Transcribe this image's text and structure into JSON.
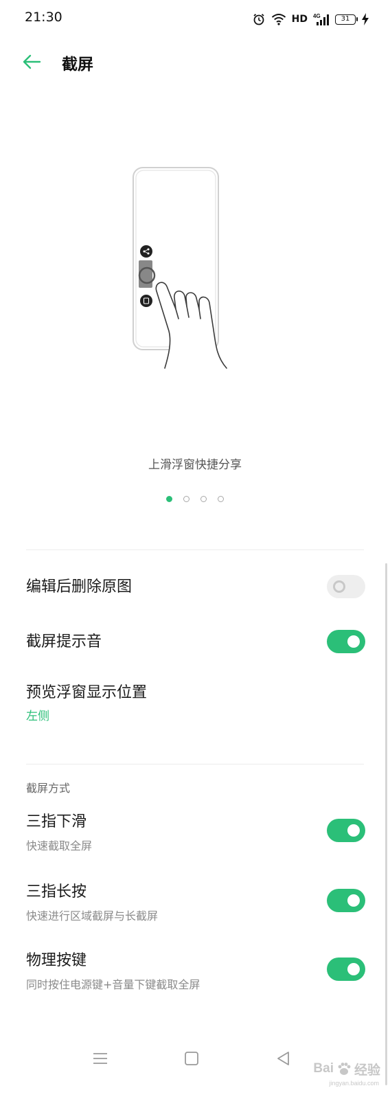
{
  "status_bar": {
    "time": "21:30",
    "network_label": "HD",
    "cell_label": "4G",
    "battery_level": "31",
    "icons": [
      "alarm-icon",
      "wifi-icon",
      "signal-icon",
      "battery-icon",
      "charging-icon"
    ]
  },
  "header": {
    "title": "截屏",
    "back_icon": "arrow-left-icon"
  },
  "illustration": {
    "caption": "上滑浮窗快捷分享",
    "pages": 4,
    "active_page": 1
  },
  "settings": [
    {
      "title": "编辑后删除原图",
      "toggle": false
    },
    {
      "title": "截屏提示音",
      "toggle": true
    },
    {
      "title": "预览浮窗显示位置",
      "value": "左侧"
    }
  ],
  "methods_section": {
    "title": "截屏方式",
    "items": [
      {
        "title": "三指下滑",
        "subtitle": "快速截取全屏",
        "toggle": true
      },
      {
        "title": "三指长按",
        "subtitle": "快速进行区域截屏与长截屏",
        "toggle": true
      },
      {
        "title": "物理按键",
        "subtitle": "同时按住电源键+音量下键截取全屏",
        "toggle": true
      }
    ]
  },
  "nav_bar": {
    "buttons": [
      "menu-icon",
      "home-icon",
      "back-triangle-icon"
    ]
  },
  "watermark": {
    "text": "Bai",
    "text2": "经验",
    "url": "jingyan.baidu.com"
  },
  "colors": {
    "accent": "#2bbf78",
    "switch_off": "#eeeeee",
    "text_primary": "#1a1a1a",
    "text_secondary": "#8a8a8a"
  }
}
